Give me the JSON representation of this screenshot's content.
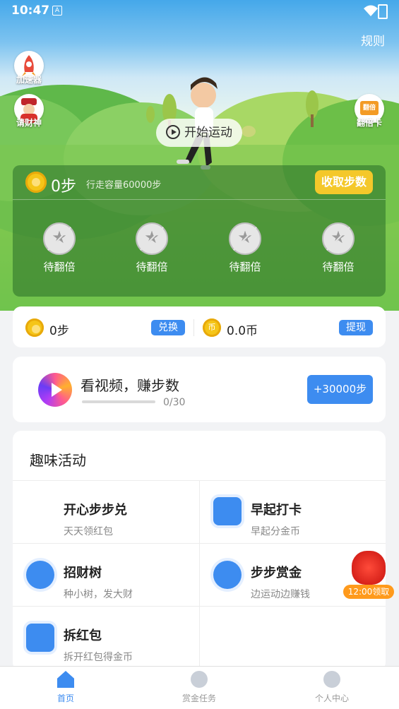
{
  "status_bar": {
    "time": "10:47",
    "app_glyph": "A"
  },
  "header": {
    "rule_label": "规则"
  },
  "side_buttons": {
    "accelerator": "加速器",
    "wealth_god": "请财神",
    "double_card": "翻倍卡",
    "double_card_inner": "翻倍"
  },
  "start_button": {
    "label": "开始运动"
  },
  "step_card": {
    "steps": "0步",
    "capacity": "行走容量60000步",
    "collect_label": "收取步数",
    "slots": [
      "待翻倍",
      "待翻倍",
      "待翻倍",
      "待翻倍"
    ]
  },
  "balance": {
    "steps": "0步",
    "exchange_label": "兑换",
    "coins": "0.0币",
    "withdraw_label": "提现"
  },
  "video_task": {
    "title": "看视频，赚步数",
    "progress_text": "0/30",
    "progress_fraction": 0,
    "reward_label": "+30000步"
  },
  "activities": {
    "title": "趣味活动",
    "items": [
      {
        "name": "开心步步兑",
        "sub": "天天领红包",
        "icon": "none"
      },
      {
        "name": "早起打卡",
        "sub": "早起分金币",
        "icon": "calendar-check-icon"
      },
      {
        "name": "招财树",
        "sub": "种小树，发大财",
        "icon": "tree-icon"
      },
      {
        "name": "步步赏金",
        "sub": "边运动边赚钱",
        "icon": "piggy-bank-icon"
      },
      {
        "name": "拆红包",
        "sub": "拆开红包得金币",
        "icon": "red-envelope-icon"
      }
    ]
  },
  "floating_reward": {
    "label": "12:00领取"
  },
  "bottom_nav": [
    {
      "label": "首页",
      "icon": "home-icon",
      "active": true
    },
    {
      "label": "赏金任务",
      "icon": "compass-icon",
      "active": false
    },
    {
      "label": "个人中心",
      "icon": "user-icon",
      "active": false
    }
  ],
  "colors": {
    "accent": "#3d8cf0",
    "gold": "#f4c82a",
    "grass": "#62c04a"
  }
}
